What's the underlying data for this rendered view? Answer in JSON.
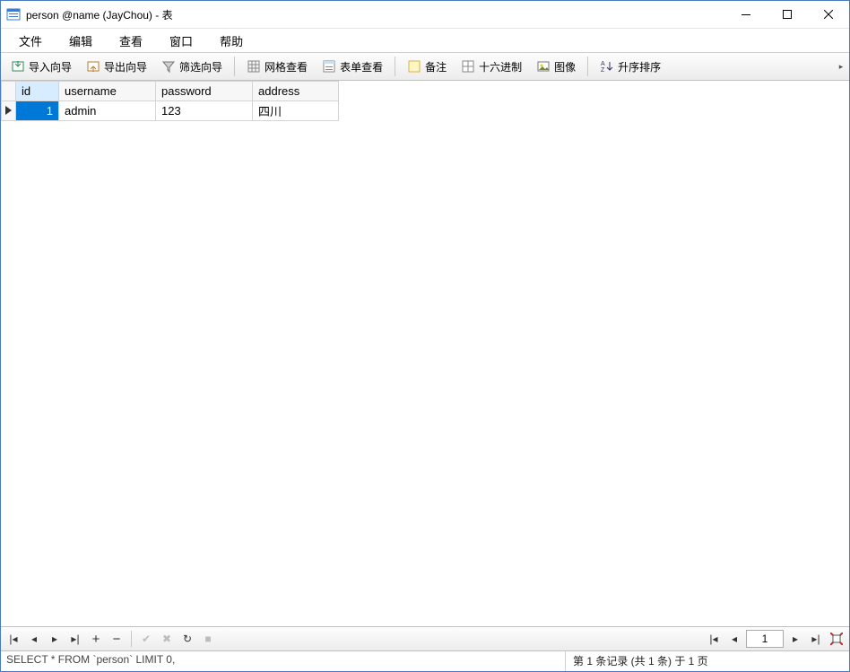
{
  "window": {
    "title": "person @name (JayChou) - 表"
  },
  "menu": {
    "file": "文件",
    "edit": "编辑",
    "view": "查看",
    "window": "窗口",
    "help": "帮助"
  },
  "toolbar": {
    "import_wizard": "导入向导",
    "export_wizard": "导出向导",
    "filter_wizard": "筛选向导",
    "grid_view": "网格查看",
    "form_view": "表单查看",
    "remarks": "备注",
    "hex": "十六进制",
    "image": "图像",
    "sort_asc": "升序排序"
  },
  "columns": {
    "id": "id",
    "username": "username",
    "password": "password",
    "address": "address"
  },
  "rows": [
    {
      "id": "1",
      "username": "admin",
      "password": "123",
      "address": "四川"
    }
  ],
  "nav": {
    "page": "1"
  },
  "status": {
    "sql": "SELECT * FROM `person` LIMIT 0,",
    "info": "第 1 条记录 (共 1 条) 于 1 页"
  }
}
